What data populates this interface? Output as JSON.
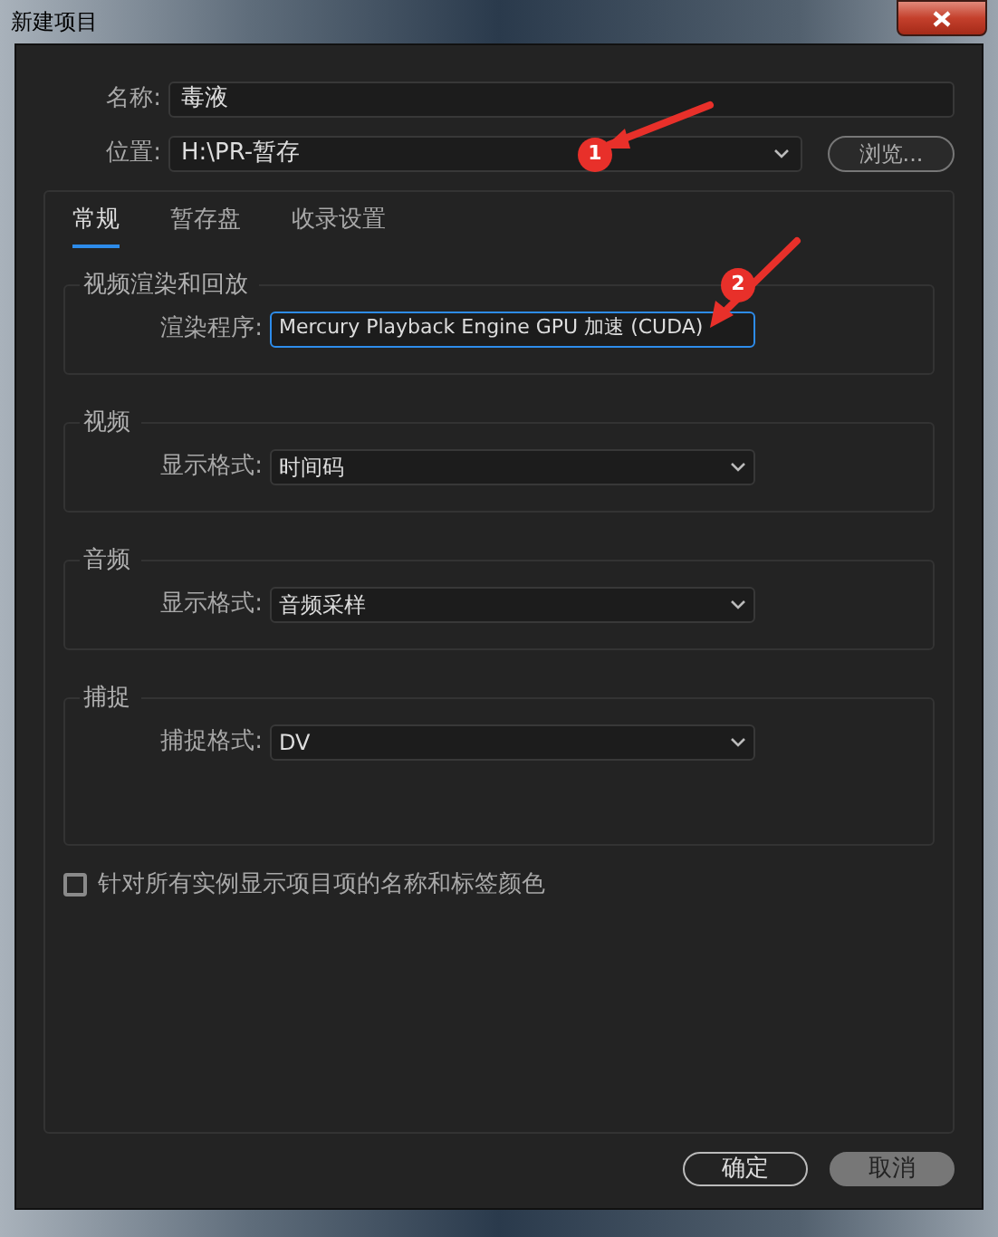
{
  "window": {
    "title": "新建项目"
  },
  "name_field": {
    "label": "名称:",
    "value": "毒液"
  },
  "location_field": {
    "label": "位置:",
    "value": "H:\\PR-暂存"
  },
  "browse_button": {
    "label": "浏览..."
  },
  "tabs": [
    {
      "label": "常规",
      "selected": true
    },
    {
      "label": "暂存盘",
      "selected": false
    },
    {
      "label": "收录设置",
      "selected": false
    }
  ],
  "groups": [
    {
      "title": "视频渲染和回放",
      "label": "渲染程序:",
      "value": "Mercury Playback Engine GPU 加速 (CUDA)",
      "focused": true,
      "tall": false
    },
    {
      "title": "视频",
      "label": "显示格式:",
      "value": "时间码",
      "focused": false,
      "tall": false
    },
    {
      "title": "音频",
      "label": "显示格式:",
      "value": "音频采样",
      "focused": false,
      "tall": false
    },
    {
      "title": "捕捉",
      "label": "捕捉格式:",
      "value": "DV",
      "focused": false,
      "tall": true
    }
  ],
  "checkbox": {
    "label": "针对所有实例显示项目项的名称和标签颜色",
    "checked": false
  },
  "buttons": [
    {
      "label": "确定",
      "kind": "outline"
    },
    {
      "label": "取消",
      "kind": "filled"
    }
  ],
  "annotations": [
    {
      "label": "1"
    },
    {
      "label": "2"
    }
  ]
}
